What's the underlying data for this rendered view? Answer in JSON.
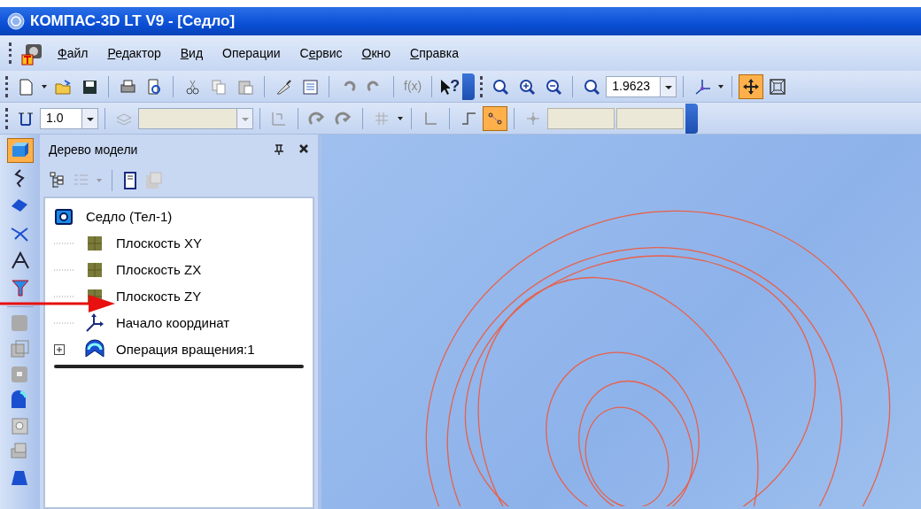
{
  "window": {
    "title": "КОМПАС-3D LT V9 - [Седло]"
  },
  "menu": [
    {
      "hotkey": "Ф",
      "after": "айл"
    },
    {
      "hotkey": "Р",
      "after": "едактор"
    },
    {
      "hotkey": "В",
      "after": "ид"
    },
    {
      "before": "Операции"
    },
    {
      "before": "С",
      "hotkey": "е",
      "after": "рвис"
    },
    {
      "hotkey": "О",
      "after": "кно"
    },
    {
      "hotkey": "С",
      "after": "правка"
    }
  ],
  "standard_toolbar": {
    "function_button": {
      "label": "f(x)"
    },
    "help_button": {
      "label": "?"
    }
  },
  "view_toolbar": {
    "scale_combo": {
      "value": "1.9623"
    },
    "pan_button": {
      "pressed": true
    },
    "fit_button": {
      "pressed": false
    }
  },
  "current_state_toolbar": {
    "step_combo": {
      "value": "1.0"
    },
    "layer_combo": {
      "disabled": true
    },
    "snap_button": {
      "pressed": true
    },
    "ortho_button": {
      "pressed": false
    }
  },
  "left_toolbar": [
    {
      "pressed": true
    },
    {
      "pressed": false
    },
    {
      "pressed": false
    },
    {
      "pressed": false
    },
    {
      "pressed": false
    },
    {
      "pressed": false
    }
  ],
  "model_tree": {
    "title": "Дерево модели",
    "items": [
      {
        "label": "Седло (Тел-1)",
        "kind": "part",
        "children": [
          {
            "label": "Плоскость XY",
            "kind": "plane"
          },
          {
            "label": "Плоскость ZX",
            "kind": "plane"
          },
          {
            "label": "Плоскость ZY",
            "kind": "plane"
          },
          {
            "label": "Начало координат",
            "kind": "origin"
          },
          {
            "label": "Операция вращения:1",
            "kind": "rotation",
            "expanded": false
          }
        ]
      }
    ]
  }
}
